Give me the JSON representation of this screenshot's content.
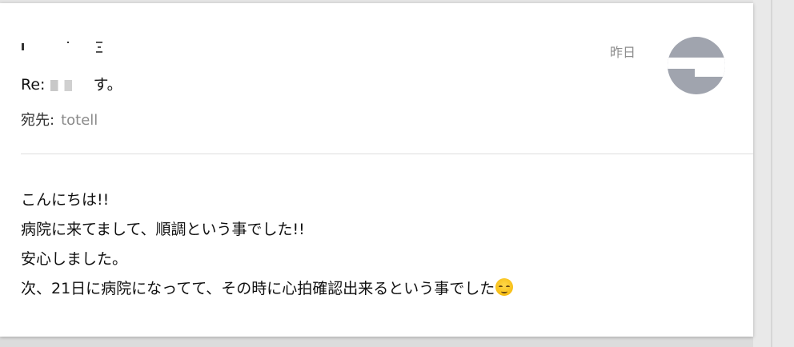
{
  "message": {
    "date": "昨日",
    "subject_prefix": "Re: ",
    "subject_suffix": "す。",
    "recipient_label": "宛先:",
    "recipient_value": "totell",
    "body_lines": [
      "こんにちは!!",
      "病院に来てまして、順調という事でした!!",
      "安心しました。",
      "次、21日に病院になってて、その時に心拍確認出来るという事でした"
    ]
  },
  "icons": {
    "avatar": "avatar-icon",
    "emoji": "relieved-face-icon"
  }
}
